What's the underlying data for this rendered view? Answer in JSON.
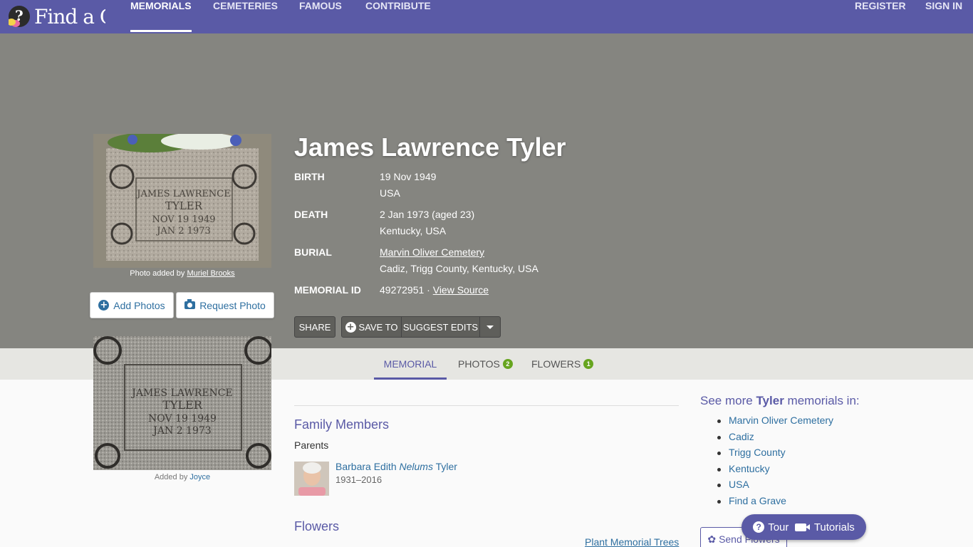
{
  "nav": {
    "logo_text": "Find a Grave",
    "links": [
      "MEMORIALS",
      "CEMETERIES",
      "FAMOUS",
      "CONTRIBUTE"
    ],
    "register": "REGISTER",
    "sign_in": "SIGN IN"
  },
  "memorial": {
    "name": "James Lawrence Tyler",
    "birth_label": "BIRTH",
    "birth_date": "19 Nov 1949",
    "birth_place": "USA",
    "death_label": "DEATH",
    "death_date": "2 Jan 1973 (aged 23)",
    "death_place": "Kentucky, USA",
    "burial_label": "BURIAL",
    "burial_cemetery": "Marvin Oliver Cemetery",
    "burial_place": "Cadiz, Trigg County, Kentucky, USA",
    "memorial_id_label": "MEMORIAL ID",
    "memorial_id": "49272951 ·",
    "view_source": "View Source"
  },
  "photo": {
    "caption_prefix": "Photo added by",
    "added_by": "Muriel Brooks",
    "add_photos": "Add Photos",
    "request_photo": "Request Photo",
    "second_caption_prefix": "Added by",
    "second_added_by": "Joyce",
    "engraving": [
      "JAMES LAWRENCE",
      "TYLER",
      "NOV 19 1949",
      "JAN 2 1973"
    ]
  },
  "actions": {
    "share": "SHARE",
    "save_to": "SAVE TO",
    "suggest_edits": "SUGGEST EDITS"
  },
  "tabs": {
    "memorial": "MEMORIAL",
    "photos": "PHOTOS",
    "photos_count": "2",
    "flowers": "FLOWERS",
    "flowers_count": "1"
  },
  "family": {
    "heading": "Family Members",
    "parents_label": "Parents",
    "parent_first": "Barbara Edith",
    "parent_maiden": "Nelums",
    "parent_last": "Tyler",
    "parent_dates": "1931–2016"
  },
  "flowers_section": {
    "heading": "Flowers",
    "plant_trees": "Plant Memorial Trees"
  },
  "sidebar": {
    "title_prefix": "See more",
    "title_name": "Tyler",
    "title_suffix": "memorials in:",
    "items": [
      "Marvin Oliver Cemetery",
      "Cadiz",
      "Trigg County",
      "Kentucky",
      "USA",
      "Find a Grave"
    ],
    "send_flowers": "Send Flowers"
  },
  "help": {
    "tour": "Tour",
    "tutorials": "Tutorials"
  }
}
